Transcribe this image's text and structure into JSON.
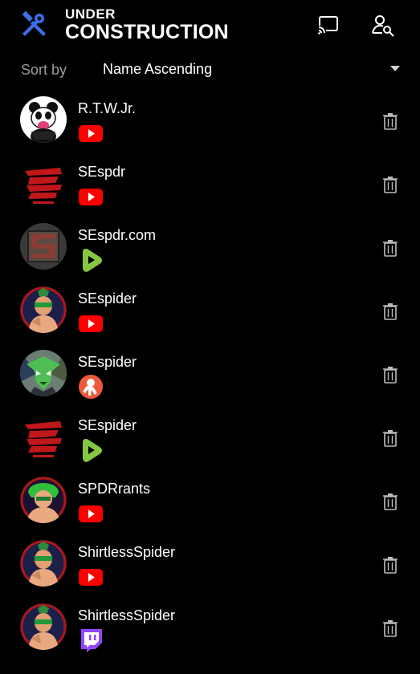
{
  "header": {
    "logo_top": "UNDER",
    "logo_bottom": "CONSTRUCTION",
    "logo_icon": "tools-icon",
    "actions": [
      "cast-icon",
      "search-user-icon"
    ],
    "accent": "#3b6fe8"
  },
  "sort": {
    "label": "Sort by",
    "value": "Name Ascending"
  },
  "channels": [
    {
      "name": "R.T.W.Jr.",
      "platform": "youtube"
    },
    {
      "name": "SEspdr",
      "platform": "youtube"
    },
    {
      "name": "SEspdr.com",
      "platform": "rumble"
    },
    {
      "name": "SEspider",
      "platform": "youtube"
    },
    {
      "name": "SEspider",
      "platform": "odysee"
    },
    {
      "name": "SEspider",
      "platform": "rumble"
    },
    {
      "name": "SPDRrants",
      "platform": "youtube"
    },
    {
      "name": "ShirtlessSpider",
      "platform": "youtube"
    },
    {
      "name": "ShirtlessSpider",
      "platform": "twitch"
    }
  ],
  "colors": {
    "youtube": "#ff0000",
    "rumble": "#85c742",
    "odysee": "#ef5a3b",
    "twitch": "#9146ff"
  }
}
